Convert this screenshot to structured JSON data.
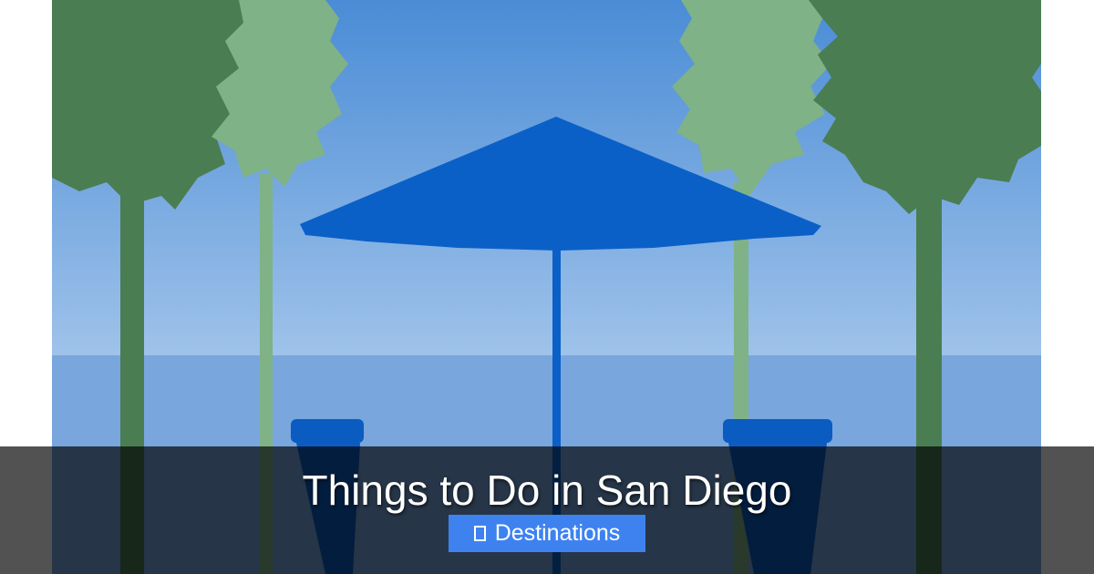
{
  "hero": {
    "title": "Things to Do in San Diego",
    "image_description_visible": false
  },
  "category": {
    "label": "Destinations",
    "icon": "folder-icon",
    "color": "#3e82f0"
  },
  "colors": {
    "sky_top": "#4b8fd8",
    "sky_bottom": "#9cc1ea",
    "sea": "#78a8de",
    "umbrella": "#0a60c7",
    "palm_dark": "#4a7d52",
    "palm_light": "#7fb286",
    "overlay": "#000000"
  }
}
